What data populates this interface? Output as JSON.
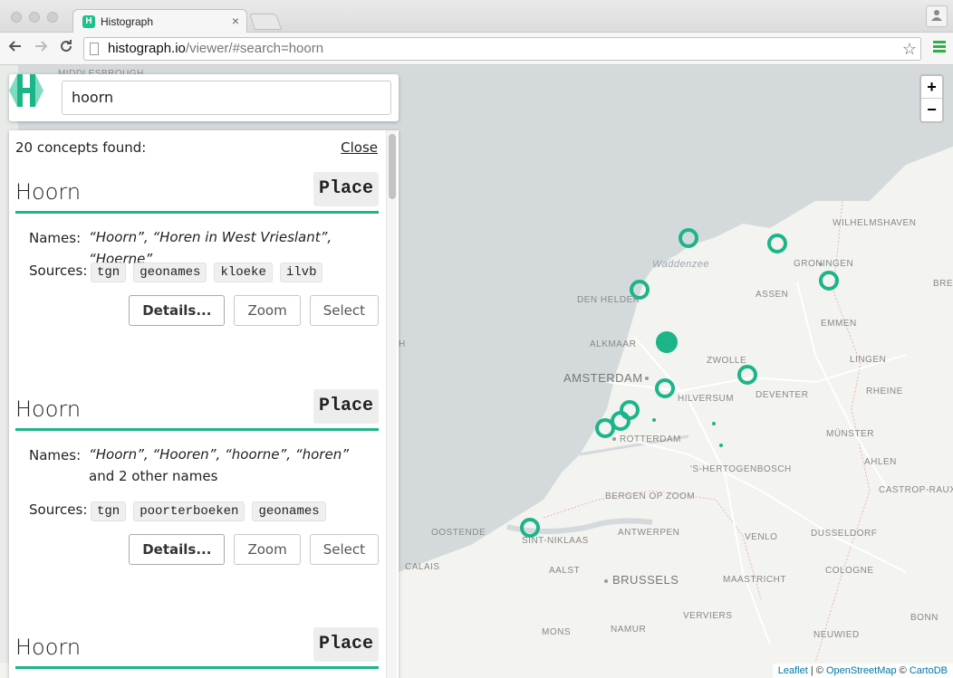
{
  "browser": {
    "tab_title": "Histograph",
    "tab_close": "×",
    "url_host": "histograph.io",
    "url_path": "/viewer/#search=hoorn",
    "back_icon": "arrow-left-icon",
    "forward_icon": "arrow-right-icon",
    "reload_icon": "reload-icon",
    "star_icon": "star-icon",
    "menu_icon": "hamburger-menu-icon",
    "profile_icon": "person-icon"
  },
  "search": {
    "value": "hoorn",
    "logo_icon": "histograph-logo-icon"
  },
  "results": {
    "count_text": "20 concepts found:",
    "close_label": "Close",
    "concepts": [
      {
        "title": "Hoorn",
        "type": "Place",
        "names_label": "Names:",
        "names": "“Hoorn”, “Horen in West Vrieslant”, “Hoerne”",
        "names_extra": "",
        "sources_label": "Sources:",
        "sources": [
          "tgn",
          "geonames",
          "kloeke",
          "ilvb"
        ],
        "details_label": "Details...",
        "zoom_label": "Zoom",
        "select_label": "Select"
      },
      {
        "title": "Hoorn",
        "type": "Place",
        "names_label": "Names:",
        "names": "“Hoorn”, “Hooren”, “hoorne”, “horen”",
        "names_extra": " and 2 other names",
        "sources_label": "Sources:",
        "sources": [
          "tgn",
          "poorterboeken",
          "geonames"
        ],
        "details_label": "Details...",
        "zoom_label": "Zoom",
        "select_label": "Select"
      },
      {
        "title": "Hoorn",
        "type": "Place"
      }
    ]
  },
  "map": {
    "zoom_in": "+",
    "zoom_out": "−",
    "water_color": "#d4dadc",
    "land_color": "#f3f3f0",
    "marker_color": "#1cb58a",
    "labels": {
      "middelsbrough": "MIDDLESBROUGH",
      "waddenzee": "Waddenzee",
      "wilhelmshaven": "WILHELMSHAVEN",
      "groningen": "GRONINGEN",
      "bre": "BRE",
      "den_helder": "DEN HELDER",
      "assen": "ASSEN",
      "emmen": "EMMEN",
      "alkmaar": "ALKMAAR",
      "zwolle": "ZWOLLE",
      "lingen": "LINGEN",
      "amsterdam": "AMSTERDAM",
      "hilversum": "HILVERSUM",
      "deventer": "DEVENTER",
      "rheine": "RHEINE",
      "rotterdam": "ROTTERDAM",
      "munster": "MÜNSTER",
      "s_hertogenbosch": "'S-HERTOGENBOSCH",
      "ahlen": "AHLEN",
      "bergen_op_zoom": "BERGEN OP ZOOM",
      "castrop_rauxel": "CASTROP-RAUXEL",
      "oostende": "OOSTENDE",
      "antwerpen": "ANTWERPEN",
      "venlo": "VENLO",
      "dusseldorf": "DUSSELDORF",
      "sint_niklaas": "SINT-NIKLAAS",
      "calais": "CALAIS",
      "aalst": "AALST",
      "cologne": "COLOGNE",
      "brussels": "BRUSSELS",
      "maastricht": "MAASTRICHT",
      "verviers": "VERVIERS",
      "mons": "MONS",
      "namur": "NAMUR",
      "neuwied": "NEUWIED",
      "bonn": "BONN",
      "h_fragment": "H"
    },
    "attribution_leaflet": "Leaflet",
    "attribution_sep1": " | © ",
    "attribution_osm": "OpenStreetMap",
    "attribution_sep2": " © ",
    "attribution_carto": "CartoDB"
  }
}
